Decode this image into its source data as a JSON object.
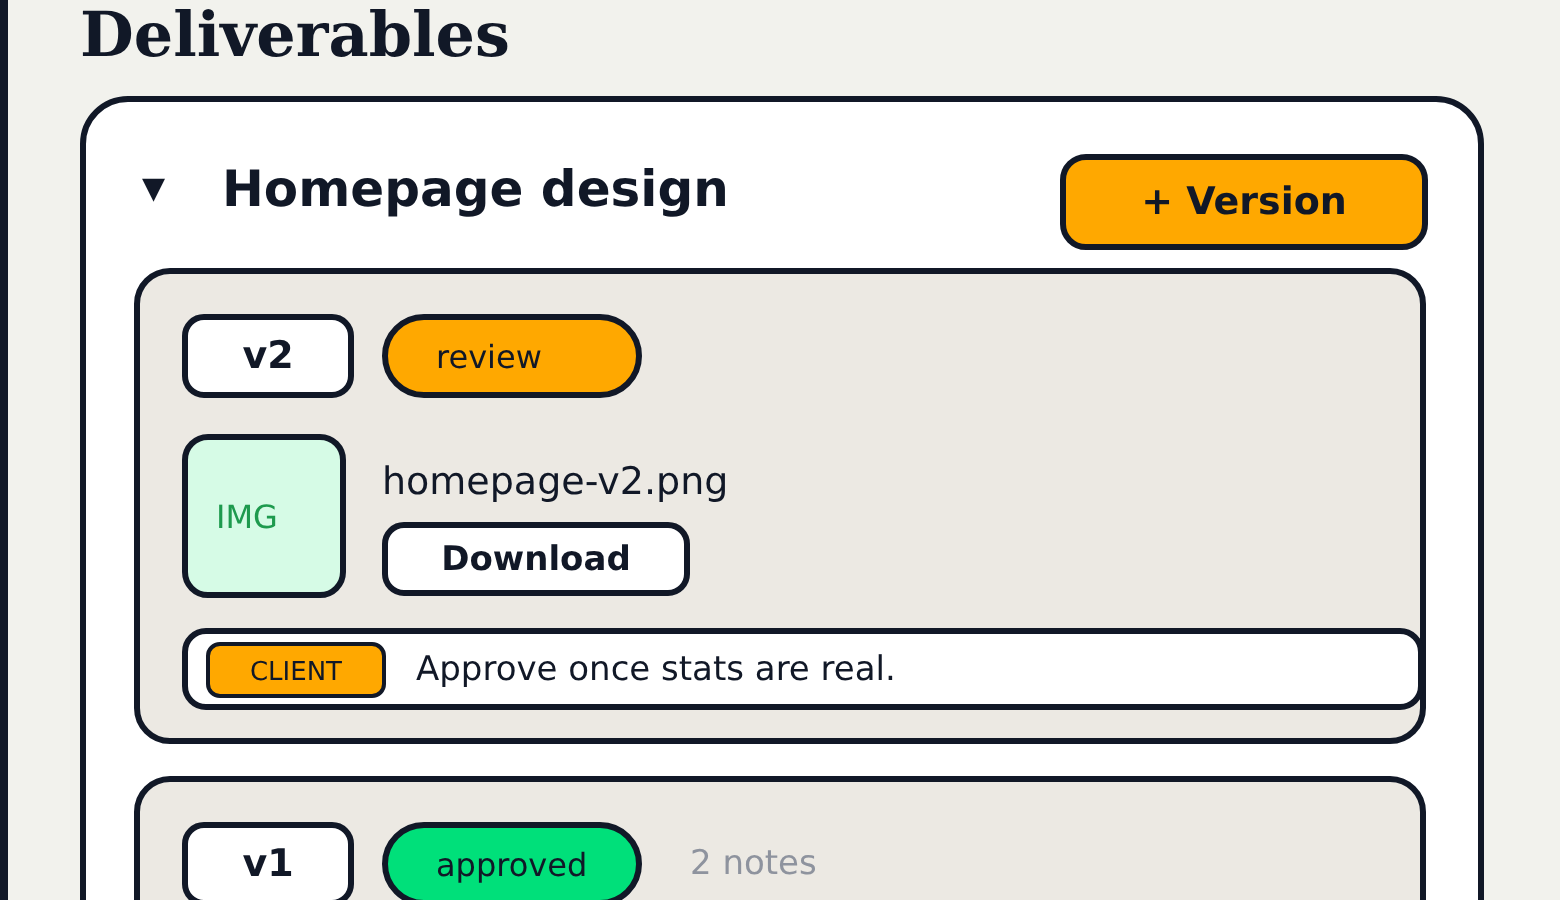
{
  "page": {
    "title": "Deliverables"
  },
  "deliverables": [
    {
      "toggle": "▼",
      "expanded": true,
      "title": "Homepage design",
      "add_button": "+ Version",
      "versions": [
        {
          "version": "v2",
          "status": "review",
          "color": "#ffa800",
          "file": {
            "thumb": "IMG",
            "name": "homepage-v2.png",
            "button": "Download"
          },
          "notes": [
            {
              "author": "CLIENT",
              "text": "Approve once stats are real."
            }
          ]
        },
        {
          "version": "v1",
          "status": "approved",
          "color": "#00e07a",
          "note_count": "2 notes"
        }
      ]
    }
  ]
}
